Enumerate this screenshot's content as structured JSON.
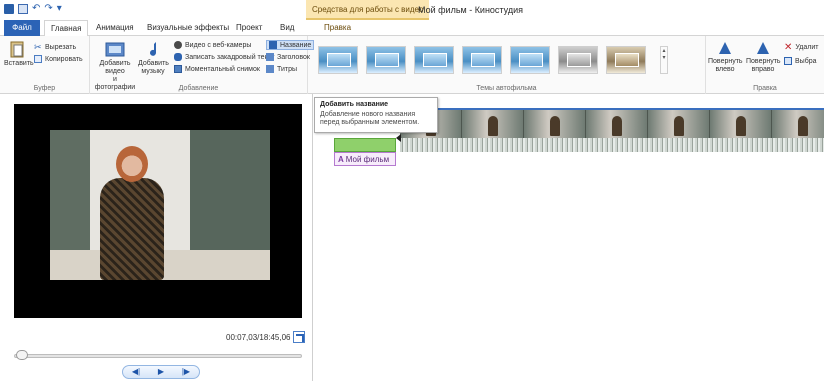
{
  "app": {
    "window_title": "Мой фильм - Киностудия",
    "context_tool_label": "Средства для работы с видео"
  },
  "tabs": {
    "file": "Файл",
    "home": "Главная",
    "animation": "Анимация",
    "visual_effects": "Визуальные эффекты",
    "project": "Проект",
    "view": "Вид",
    "edit": "Правка"
  },
  "ribbon": {
    "clipboard": {
      "paste": "Вставить",
      "cut": "Вырезать",
      "copy": "Копировать",
      "group_label": "Буфер"
    },
    "add": {
      "add_video_photo_line1": "Добавить видео",
      "add_video_photo_line2": "и фотографии",
      "add_music_line1": "Добавить",
      "add_music_line2": "музыку",
      "webcam_video": "Видео с веб-камеры",
      "record_narration": "Записать закадровый текст",
      "snapshot": "Моментальный снимок",
      "title": "Название",
      "caption": "Заголовок",
      "credits": "Титры",
      "group_label": "Добавление"
    },
    "themes": {
      "group_label": "Темы автофильма"
    },
    "edit": {
      "rotate_left_line1": "Повернуть",
      "rotate_left_line2": "влево",
      "rotate_right_line1": "Повернуть",
      "rotate_right_line2": "вправо",
      "delete": "Удалит",
      "select": "Выбра",
      "group_label": "Правка"
    }
  },
  "tooltip": {
    "title": "Добавить название",
    "desc_line1": "Добавление нового названия",
    "desc_line2": "перед выбранным элементом."
  },
  "preview": {
    "timecode": "00:07,03/18:45,06"
  },
  "storyboard": {
    "title_clip_text": "Мой фильм",
    "title_glyph": "A"
  },
  "colors": {
    "accent": "#2b63b6",
    "context_tab": "#fbe6b2",
    "title_clip": "#8fd06b"
  }
}
